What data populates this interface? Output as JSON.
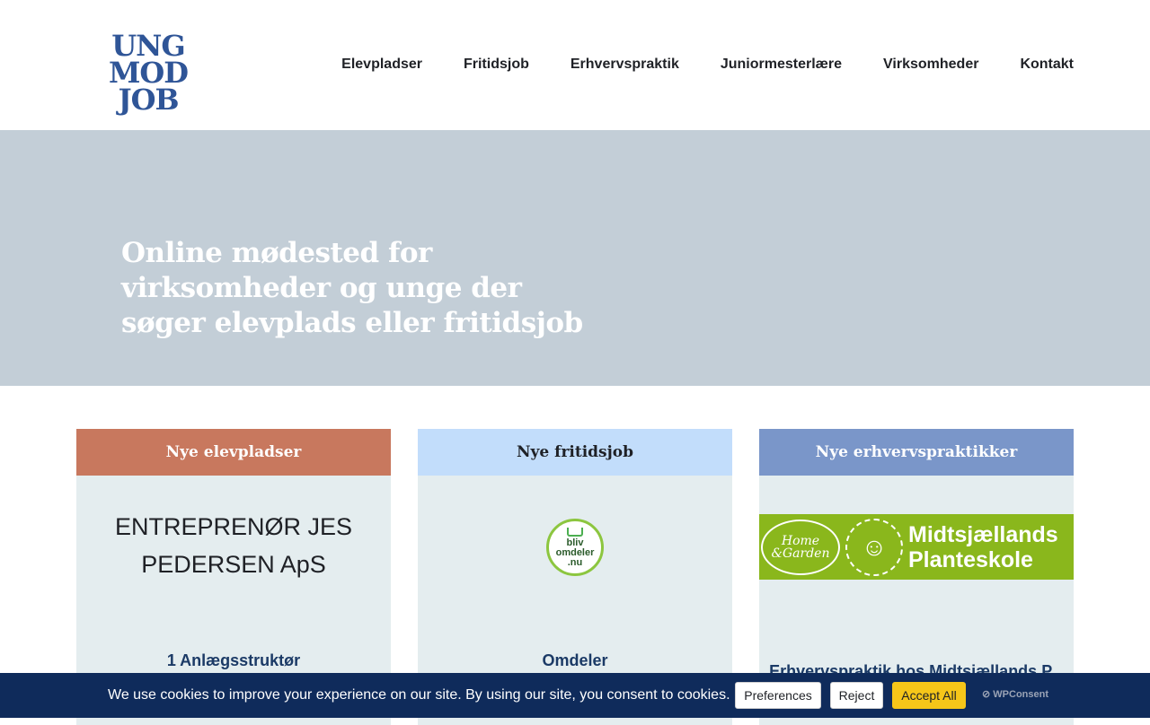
{
  "header": {
    "logo_lines": [
      "UNG",
      "MOD",
      "JOB"
    ],
    "nav": [
      "Elevpladser",
      "Fritidsjob",
      "Erhvervspraktik",
      "Juniormesterlære",
      "Virksomheder",
      "Kontakt"
    ]
  },
  "hero": {
    "title": "Online mødested for virksomheder og unge der søger elevplads eller fritidsjob"
  },
  "cards": [
    {
      "heading": "Nye elevpladser",
      "company": "ENTREPRENØR JES PEDERSEN ApS",
      "job": "1 Anlægsstruktør"
    },
    {
      "heading": "Nye fritidsjob",
      "logo_lines": [
        "bliv",
        "omdeler",
        ".nu"
      ],
      "job": "Omdeler"
    },
    {
      "heading": "Nye erhvervspraktikker",
      "logo_left": [
        "Home",
        "&Garden"
      ],
      "logo_right": [
        "Midtsjællands",
        "Planteskole"
      ],
      "job": "Erhvervspraktik hos Midtsjællands P..."
    }
  ],
  "cookie": {
    "text": "We use cookies to improve your experience on our site. By using our site, you consent to cookies.",
    "preferences": "Preferences",
    "reject": "Reject",
    "accept": "Accept All",
    "brand": "WPConsent"
  },
  "colors": {
    "nav_text": "#1f2126",
    "hero_bg": "#c3ced7",
    "card1_head": "#c8785e",
    "card2_head": "#c2ddfb",
    "card3_head": "#7a96c9",
    "cookie_bg": "#0f2b5b",
    "accept_bg": "#f6c619"
  }
}
